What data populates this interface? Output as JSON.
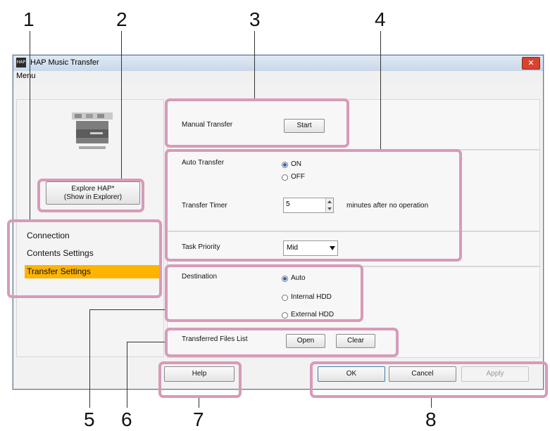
{
  "callouts": [
    "1",
    "2",
    "3",
    "4",
    "5",
    "6",
    "7",
    "8"
  ],
  "window": {
    "title": "HAP Music Transfer",
    "app_icon_text": "HAP",
    "close_glyph": "✕",
    "menu_label": "Menu"
  },
  "left": {
    "explore_button_line1": "Explore HAP*",
    "explore_button_line2": "(Show in Explorer)",
    "nav": [
      {
        "label": "Connection"
      },
      {
        "label": "Contents Settings"
      },
      {
        "label": "Transfer Settings",
        "selected": true
      }
    ]
  },
  "manual": {
    "label": "Manual Transfer",
    "start_button": "Start"
  },
  "auto": {
    "label": "Auto Transfer",
    "on_label": "ON",
    "off_label": "OFF",
    "selected": "ON",
    "timer_label": "Transfer Timer",
    "timer_value": "5",
    "timer_suffix": "minutes after no operation"
  },
  "priority": {
    "label": "Task Priority",
    "value": "Mid"
  },
  "destination": {
    "label": "Destination",
    "options": [
      "Auto",
      "Internal HDD",
      "External HDD"
    ],
    "selected": "Auto"
  },
  "files": {
    "label": "Transferred Files List",
    "open_button": "Open",
    "clear_button": "Clear"
  },
  "footer": {
    "help_button": "Help",
    "ok_button": "OK",
    "cancel_button": "Cancel",
    "apply_button": "Apply"
  },
  "colors": {
    "highlight_border": "#d79bb8",
    "selected_nav": "#ffb400",
    "window_border": "#6b7b8c"
  },
  "icons": [
    "device-icon",
    "spinner-arrows-icon",
    "dropdown-arrow-icon"
  ]
}
